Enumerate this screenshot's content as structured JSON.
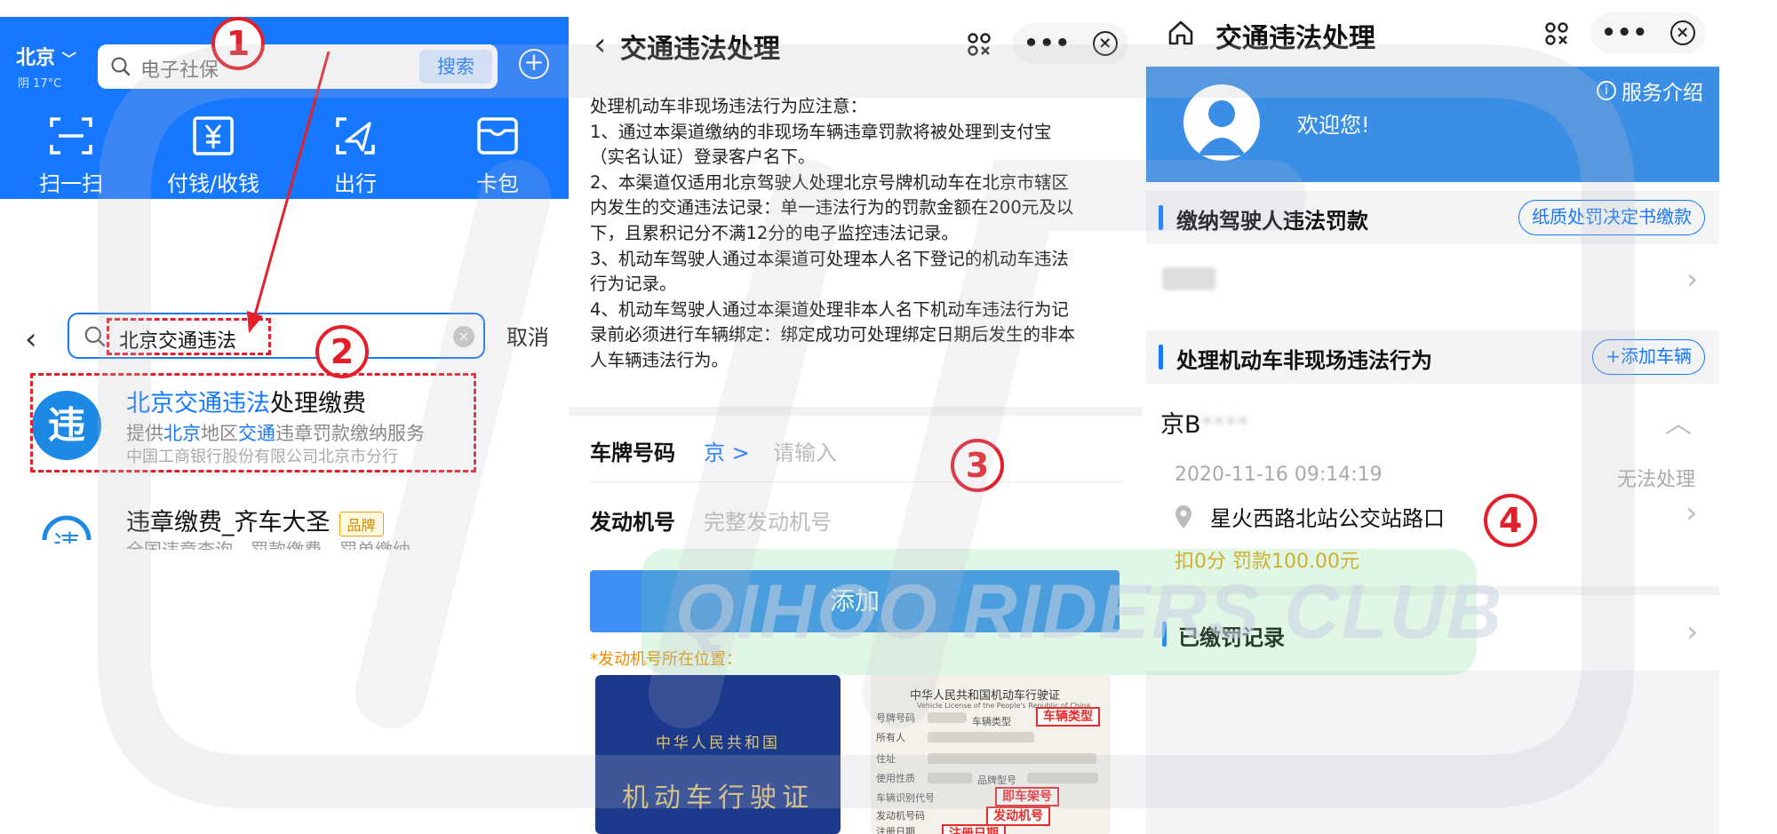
{
  "panel1": {
    "city": "北京",
    "weather": "阴 17°C",
    "search_placeholder": "电子社保",
    "search_button": "搜索",
    "plus": "+",
    "quick_actions": [
      {
        "label": "扫一扫",
        "icon": "scan-icon"
      },
      {
        "label": "付钱/收钱",
        "icon": "pay-icon"
      },
      {
        "label": "出行",
        "icon": "travel-icon"
      },
      {
        "label": "卡包",
        "icon": "card-wallet-icon"
      }
    ],
    "search_query": "北京交通违法",
    "cancel": "取消",
    "result1": {
      "icon_text": "违",
      "title_hl": "北京交通违法",
      "title_rest": "处理缴费",
      "desc": [
        "提供",
        "北京",
        "地区",
        "交通",
        "违章罚款缴纳服务"
      ],
      "org": "中国工商银行股份有限公司北京市分行"
    },
    "result2": {
      "title": "违章缴费_齐车大圣",
      "badge": "品牌",
      "desc": "全国违章查询，罚款缴费，罚单缴纳"
    }
  },
  "panel2": {
    "title": "交通违法处理",
    "notice": [
      "处理机动车非现场违法行为应注意：",
      "1、通过本渠道缴纳的非现场车辆违章罚款将被处理到支付宝",
      "（实名认证）登录客户名下。",
      "2、本渠道仅适用北京驾驶人处理北京号牌机动车在北京市辖区",
      "内发生的交通违法记录：单一违法行为的罚款金额在200元及以",
      "下，且累积记分不满12分的电子监控违法记录。",
      "3、机动车驾驶人通过本渠道可处理本人名下登记的机动车违法",
      "行为记录。",
      "4、机动车驾驶人通过本渠道处理非本人名下机动车违法行为记",
      "录前必须进行车辆绑定：绑定成功可处理绑定日期后发生的非本",
      "人车辆违法行为。"
    ],
    "plate_label": "车牌号码",
    "plate_prefix": "京 >",
    "plate_placeholder": "请输入",
    "engine_label": "发动机号",
    "engine_placeholder": "完整发动机号",
    "add_button": "添加",
    "engine_note": "*发动机号所在位置：",
    "book_line1": "中华人民共和国",
    "book_line2": "机动车行驶证",
    "license": {
      "header_cn": "中华人民共和国机动车行驶证",
      "header_en": "Vehicle License of the People's Republic of China",
      "labels": [
        "号牌号码",
        "所有人",
        "住址",
        "使用性质",
        "车辆识别代号",
        "发动机号码",
        "注册日期"
      ],
      "type_label": "车辆类型",
      "model_label": "品牌型号",
      "box_type": "车辆类型",
      "box_vin": "即车架号",
      "box_engine": "发动机号",
      "box_date": "注册日期"
    }
  },
  "panel3": {
    "title": "交通违法处理",
    "service_intro": "服务介绍",
    "welcome": "欢迎您!",
    "sec1_label": "缴纳驾驶人违法罚款",
    "sec1_btn": "纸质处罚决定书缴款",
    "driver_name": "**",
    "sec2_label": "处理机动车非现场违法行为",
    "sec2_btn": "+添加车辆",
    "plate": "京B",
    "plate_masked": "****",
    "record_time": "2020-11-16 09:14:19",
    "record_status": "无法处理",
    "location": "星火西路北站公交站路口",
    "penalty": "扣0分 罚款100.00元",
    "sec3_label": "已缴罚记录"
  },
  "watermark": "QIHOO RIDERS CLUB",
  "annotations": [
    "1",
    "2",
    "3",
    "4"
  ],
  "colors": {
    "primary": "#1677ff",
    "annotation": "#e3202a",
    "warn": "#f08a00",
    "penalty": "#e8a317"
  }
}
